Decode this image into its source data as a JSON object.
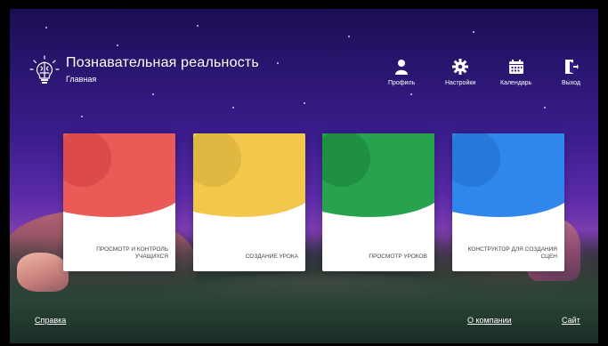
{
  "header": {
    "title": "Познавательная реальность",
    "subtitle": "Главная",
    "logo_icon": "lightbulb-brain-icon"
  },
  "nav": [
    {
      "label": "Профиль",
      "icon": "user-icon"
    },
    {
      "label": "Настройки",
      "icon": "gear-icon"
    },
    {
      "label": "Календарь",
      "icon": "calendar-icon"
    },
    {
      "label": "Выход",
      "icon": "door-exit-icon"
    }
  ],
  "cards": [
    {
      "label": "ПРОСМОТР И КОНТРОЛЬ УЧАЩИХСЯ",
      "color": "#ea5a56",
      "shade": "#d9484a"
    },
    {
      "label": "СОЗДАНИЕ УРОКА",
      "color": "#f2c74c",
      "shade": "#ddb43f"
    },
    {
      "label": "ПРОСМОТР УРОКОВ",
      "color": "#27a24d",
      "shade": "#1e8c41"
    },
    {
      "label": "КОНСТРУКТОР ДЛЯ СОЗДАНИЯ СЦЕН",
      "color": "#2f86ec",
      "shade": "#2475d6"
    }
  ],
  "footer": {
    "help": "Справка",
    "about": "О компании",
    "site": "Сайт"
  }
}
